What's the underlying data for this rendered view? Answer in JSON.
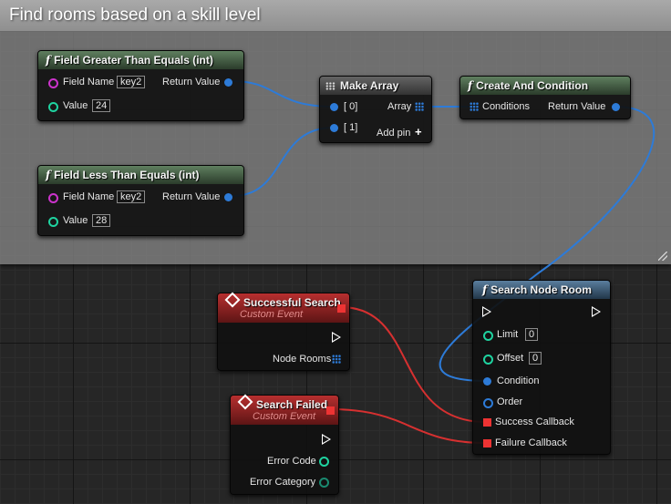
{
  "comment": {
    "title": "Find rooms based on a skill level"
  },
  "nodes": {
    "field_gte": {
      "title": "Field Greater Than Equals (int)",
      "field_name_label": "Field Name",
      "field_name_value": "key2",
      "return_label": "Return Value",
      "value_label": "Value",
      "value_value": "24"
    },
    "field_lte": {
      "title": "Field Less Than Equals (int)",
      "field_name_label": "Field Name",
      "field_name_value": "key2",
      "return_label": "Return Value",
      "value_label": "Value",
      "value_value": "28"
    },
    "make_array": {
      "title": "Make Array",
      "pin0": "[ 0]",
      "pin1": "[ 1]",
      "array_label": "Array",
      "add_pin": "Add pin"
    },
    "create_and": {
      "title": "Create And Condition",
      "conditions_label": "Conditions",
      "return_label": "Return Value"
    },
    "search_node": {
      "title": "Search Node Room",
      "limit_label": "Limit",
      "limit_value": "0",
      "offset_label": "Offset",
      "offset_value": "0",
      "condition_label": "Condition",
      "order_label": "Order",
      "success_label": "Success Callback",
      "failure_label": "Failure Callback"
    },
    "successful_search": {
      "title": "Successful Search",
      "subtitle": "Custom Event",
      "output_label": "Node Rooms"
    },
    "search_failed": {
      "title": "Search Failed",
      "subtitle": "Custom Event",
      "error_code": "Error Code",
      "error_category": "Error Category"
    }
  },
  "colors": {
    "object_pin": "#2d7bd8",
    "name_pin": "#cc33cc",
    "int_pin": "#1fd3a0",
    "delegate_pin": "#ee3333",
    "exec_pin": "#ffffff"
  }
}
